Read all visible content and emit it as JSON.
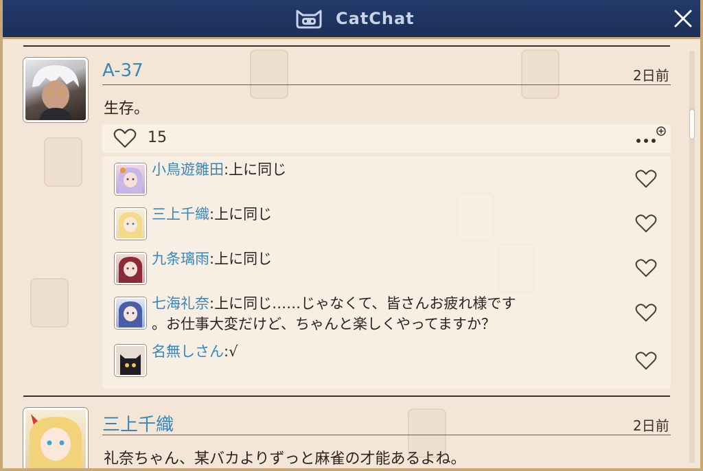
{
  "window": {
    "title": "CatChat",
    "accent": "#3a86b8",
    "titlebar_color": "#1c2f58"
  },
  "posts": [
    {
      "username": "A-37",
      "time": "2日前",
      "text": "生存。",
      "likes": "15",
      "replies": [
        {
          "name": "小鳥遊雛田",
          "sep": ":",
          "text": "上に同じ"
        },
        {
          "name": "三上千織",
          "sep": ":",
          "text": "上に同じ"
        },
        {
          "name": "九条璃雨",
          "sep": ":",
          "text": "上に同じ"
        },
        {
          "name": "七海礼奈",
          "sep": ":",
          "text": "上に同じ……じゃなくて、皆さんお疲れ様です",
          "text2": "。お仕事大変だけど、ちゃんと楽しくやってますか？"
        },
        {
          "name": "名無しさん",
          "sep": ":",
          "text": "√"
        }
      ]
    },
    {
      "username": "三上千織",
      "time": "2日前",
      "text": "礼奈ちゃん、某バカよりずっと麻雀の才能あるよね。"
    }
  ],
  "icons": {
    "logo": "cat-head-icon",
    "close": "close-icon",
    "like": "heart-icon",
    "more": "more-options-icon"
  }
}
